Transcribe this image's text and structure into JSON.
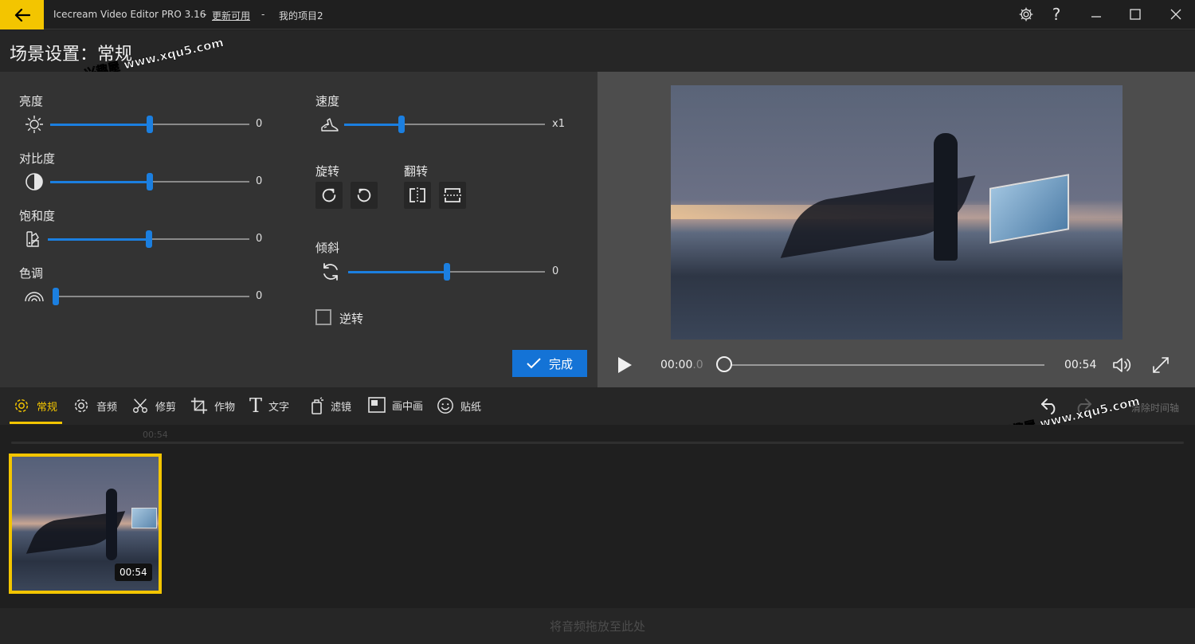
{
  "titlebar": {
    "app_name": "Icecream Video Editor PRO 3.16",
    "sep1": "-",
    "update_link": "更新可用",
    "sep2": "-",
    "project_name": "我的项目2"
  },
  "header": {
    "title": "场景设置：常规",
    "watermark": "兴趣屋 www.xqu5.com"
  },
  "settings": {
    "brightness": {
      "label": "亮度",
      "value": "0",
      "position": 0.5
    },
    "contrast": {
      "label": "对比度",
      "value": "0",
      "position": 0.5
    },
    "saturation": {
      "label": "饱和度",
      "value": "0",
      "position": 0.5
    },
    "hue": {
      "label": "色调",
      "value": "0",
      "position": 0.0
    },
    "speed": {
      "label": "速度",
      "value": "x1",
      "position": 0.28
    },
    "rotate": {
      "label": "旋转"
    },
    "flip": {
      "label": "翻转"
    },
    "tilt": {
      "label": "倾斜",
      "value": "0",
      "position": 0.5
    },
    "reverse": {
      "label": "逆转",
      "checked": false
    },
    "done_label": "完成"
  },
  "player": {
    "current_time": "00:00",
    "current_time_ms": ".0",
    "duration": "00:54",
    "progress": 0.0
  },
  "toolbar": {
    "tabs": [
      {
        "label": "常规",
        "icon": "gear-icon"
      },
      {
        "label": "音频",
        "icon": "gear-icon"
      },
      {
        "label": "修剪",
        "icon": "scissors-icon"
      },
      {
        "label": "作物",
        "icon": "crop-icon"
      },
      {
        "label": "文字",
        "icon": "text-icon"
      },
      {
        "label": "滤镜",
        "icon": "filter-icon"
      },
      {
        "label": "画中画",
        "icon": "pip-icon"
      },
      {
        "label": "贴纸",
        "icon": "sticker-icon"
      }
    ],
    "clear_timeline": "清除时间轴",
    "watermark": "兴趣屋 www.xqu5.com"
  },
  "timeline": {
    "ruler_label": "00:54",
    "clip_duration": "00:54",
    "audio_drop_text": "将音频拖放至此处"
  },
  "colors": {
    "accent": "#f3c500",
    "primary_blue": "#1473d6"
  }
}
